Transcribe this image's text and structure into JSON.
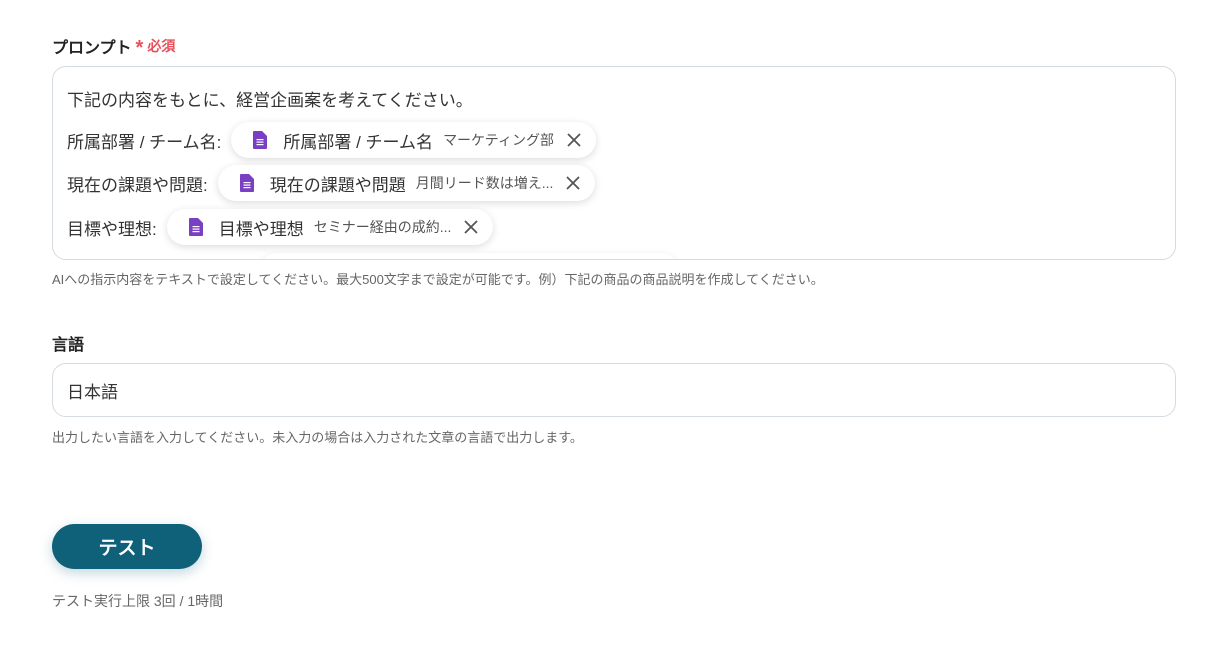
{
  "prompt": {
    "label": "プロンプト",
    "required_star": "*",
    "required_text": "必須",
    "first_line": "下記の内容をもとに、経営企画案を考えてください。",
    "rows": [
      {
        "label": "所属部署 / チーム名:",
        "chip_name": "所属部署 / チーム名",
        "chip_value": "マーケティング部"
      },
      {
        "label": "現在の課題や問題:",
        "chip_name": "現在の課題や問題",
        "chip_value": "月間リード数は増え..."
      },
      {
        "label": "目標や理想:",
        "chip_name": "目標や理想",
        "chip_value": "セミナー経由の成約..."
      }
    ],
    "hint": "AIへの指示内容をテキストで設定してください。最大500文字まで設定が可能です。例）下記の商品の商品説明を作成してください。"
  },
  "language": {
    "label": "言語",
    "value": "日本語",
    "hint": "出力したい言語を入力してください。未入力の場合は入力された文章の言語で出力します。"
  },
  "test": {
    "button_label": "テスト",
    "limit_text": "テスト実行上限 3回 / 1時間"
  },
  "icons": {
    "chip_icon": "google-sheets-doc-icon",
    "chip_icon_color": "#7b3fc4",
    "remove_icon": "close-icon"
  },
  "colors": {
    "accent": "#0f6179",
    "required": "#e8505b"
  }
}
